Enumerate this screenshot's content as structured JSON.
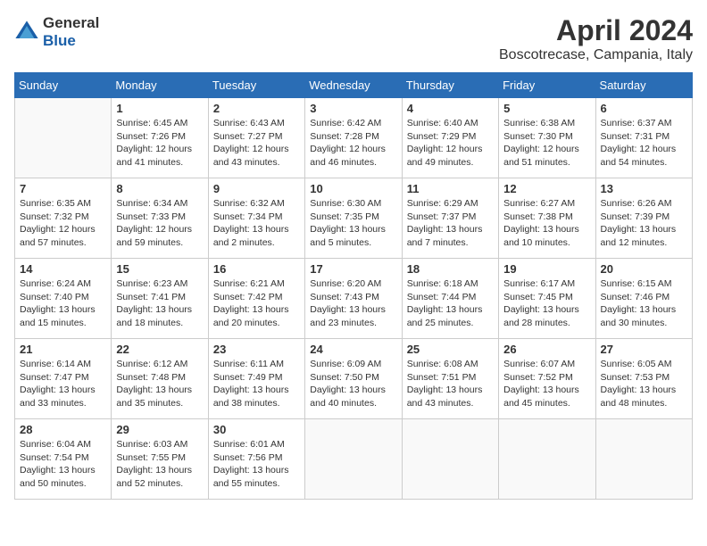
{
  "header": {
    "logo_general": "General",
    "logo_blue": "Blue",
    "month": "April 2024",
    "location": "Boscotrecase, Campania, Italy"
  },
  "calendar": {
    "weekdays": [
      "Sunday",
      "Monday",
      "Tuesday",
      "Wednesday",
      "Thursday",
      "Friday",
      "Saturday"
    ],
    "weeks": [
      [
        {
          "day": "",
          "sunrise": "",
          "sunset": "",
          "daylight": ""
        },
        {
          "day": "1",
          "sunrise": "Sunrise: 6:45 AM",
          "sunset": "Sunset: 7:26 PM",
          "daylight": "Daylight: 12 hours and 41 minutes."
        },
        {
          "day": "2",
          "sunrise": "Sunrise: 6:43 AM",
          "sunset": "Sunset: 7:27 PM",
          "daylight": "Daylight: 12 hours and 43 minutes."
        },
        {
          "day": "3",
          "sunrise": "Sunrise: 6:42 AM",
          "sunset": "Sunset: 7:28 PM",
          "daylight": "Daylight: 12 hours and 46 minutes."
        },
        {
          "day": "4",
          "sunrise": "Sunrise: 6:40 AM",
          "sunset": "Sunset: 7:29 PM",
          "daylight": "Daylight: 12 hours and 49 minutes."
        },
        {
          "day": "5",
          "sunrise": "Sunrise: 6:38 AM",
          "sunset": "Sunset: 7:30 PM",
          "daylight": "Daylight: 12 hours and 51 minutes."
        },
        {
          "day": "6",
          "sunrise": "Sunrise: 6:37 AM",
          "sunset": "Sunset: 7:31 PM",
          "daylight": "Daylight: 12 hours and 54 minutes."
        }
      ],
      [
        {
          "day": "7",
          "sunrise": "Sunrise: 6:35 AM",
          "sunset": "Sunset: 7:32 PM",
          "daylight": "Daylight: 12 hours and 57 minutes."
        },
        {
          "day": "8",
          "sunrise": "Sunrise: 6:34 AM",
          "sunset": "Sunset: 7:33 PM",
          "daylight": "Daylight: 12 hours and 59 minutes."
        },
        {
          "day": "9",
          "sunrise": "Sunrise: 6:32 AM",
          "sunset": "Sunset: 7:34 PM",
          "daylight": "Daylight: 13 hours and 2 minutes."
        },
        {
          "day": "10",
          "sunrise": "Sunrise: 6:30 AM",
          "sunset": "Sunset: 7:35 PM",
          "daylight": "Daylight: 13 hours and 5 minutes."
        },
        {
          "day": "11",
          "sunrise": "Sunrise: 6:29 AM",
          "sunset": "Sunset: 7:37 PM",
          "daylight": "Daylight: 13 hours and 7 minutes."
        },
        {
          "day": "12",
          "sunrise": "Sunrise: 6:27 AM",
          "sunset": "Sunset: 7:38 PM",
          "daylight": "Daylight: 13 hours and 10 minutes."
        },
        {
          "day": "13",
          "sunrise": "Sunrise: 6:26 AM",
          "sunset": "Sunset: 7:39 PM",
          "daylight": "Daylight: 13 hours and 12 minutes."
        }
      ],
      [
        {
          "day": "14",
          "sunrise": "Sunrise: 6:24 AM",
          "sunset": "Sunset: 7:40 PM",
          "daylight": "Daylight: 13 hours and 15 minutes."
        },
        {
          "day": "15",
          "sunrise": "Sunrise: 6:23 AM",
          "sunset": "Sunset: 7:41 PM",
          "daylight": "Daylight: 13 hours and 18 minutes."
        },
        {
          "day": "16",
          "sunrise": "Sunrise: 6:21 AM",
          "sunset": "Sunset: 7:42 PM",
          "daylight": "Daylight: 13 hours and 20 minutes."
        },
        {
          "day": "17",
          "sunrise": "Sunrise: 6:20 AM",
          "sunset": "Sunset: 7:43 PM",
          "daylight": "Daylight: 13 hours and 23 minutes."
        },
        {
          "day": "18",
          "sunrise": "Sunrise: 6:18 AM",
          "sunset": "Sunset: 7:44 PM",
          "daylight": "Daylight: 13 hours and 25 minutes."
        },
        {
          "day": "19",
          "sunrise": "Sunrise: 6:17 AM",
          "sunset": "Sunset: 7:45 PM",
          "daylight": "Daylight: 13 hours and 28 minutes."
        },
        {
          "day": "20",
          "sunrise": "Sunrise: 6:15 AM",
          "sunset": "Sunset: 7:46 PM",
          "daylight": "Daylight: 13 hours and 30 minutes."
        }
      ],
      [
        {
          "day": "21",
          "sunrise": "Sunrise: 6:14 AM",
          "sunset": "Sunset: 7:47 PM",
          "daylight": "Daylight: 13 hours and 33 minutes."
        },
        {
          "day": "22",
          "sunrise": "Sunrise: 6:12 AM",
          "sunset": "Sunset: 7:48 PM",
          "daylight": "Daylight: 13 hours and 35 minutes."
        },
        {
          "day": "23",
          "sunrise": "Sunrise: 6:11 AM",
          "sunset": "Sunset: 7:49 PM",
          "daylight": "Daylight: 13 hours and 38 minutes."
        },
        {
          "day": "24",
          "sunrise": "Sunrise: 6:09 AM",
          "sunset": "Sunset: 7:50 PM",
          "daylight": "Daylight: 13 hours and 40 minutes."
        },
        {
          "day": "25",
          "sunrise": "Sunrise: 6:08 AM",
          "sunset": "Sunset: 7:51 PM",
          "daylight": "Daylight: 13 hours and 43 minutes."
        },
        {
          "day": "26",
          "sunrise": "Sunrise: 6:07 AM",
          "sunset": "Sunset: 7:52 PM",
          "daylight": "Daylight: 13 hours and 45 minutes."
        },
        {
          "day": "27",
          "sunrise": "Sunrise: 6:05 AM",
          "sunset": "Sunset: 7:53 PM",
          "daylight": "Daylight: 13 hours and 48 minutes."
        }
      ],
      [
        {
          "day": "28",
          "sunrise": "Sunrise: 6:04 AM",
          "sunset": "Sunset: 7:54 PM",
          "daylight": "Daylight: 13 hours and 50 minutes."
        },
        {
          "day": "29",
          "sunrise": "Sunrise: 6:03 AM",
          "sunset": "Sunset: 7:55 PM",
          "daylight": "Daylight: 13 hours and 52 minutes."
        },
        {
          "day": "30",
          "sunrise": "Sunrise: 6:01 AM",
          "sunset": "Sunset: 7:56 PM",
          "daylight": "Daylight: 13 hours and 55 minutes."
        },
        {
          "day": "",
          "sunrise": "",
          "sunset": "",
          "daylight": ""
        },
        {
          "day": "",
          "sunrise": "",
          "sunset": "",
          "daylight": ""
        },
        {
          "day": "",
          "sunrise": "",
          "sunset": "",
          "daylight": ""
        },
        {
          "day": "",
          "sunrise": "",
          "sunset": "",
          "daylight": ""
        }
      ]
    ]
  }
}
